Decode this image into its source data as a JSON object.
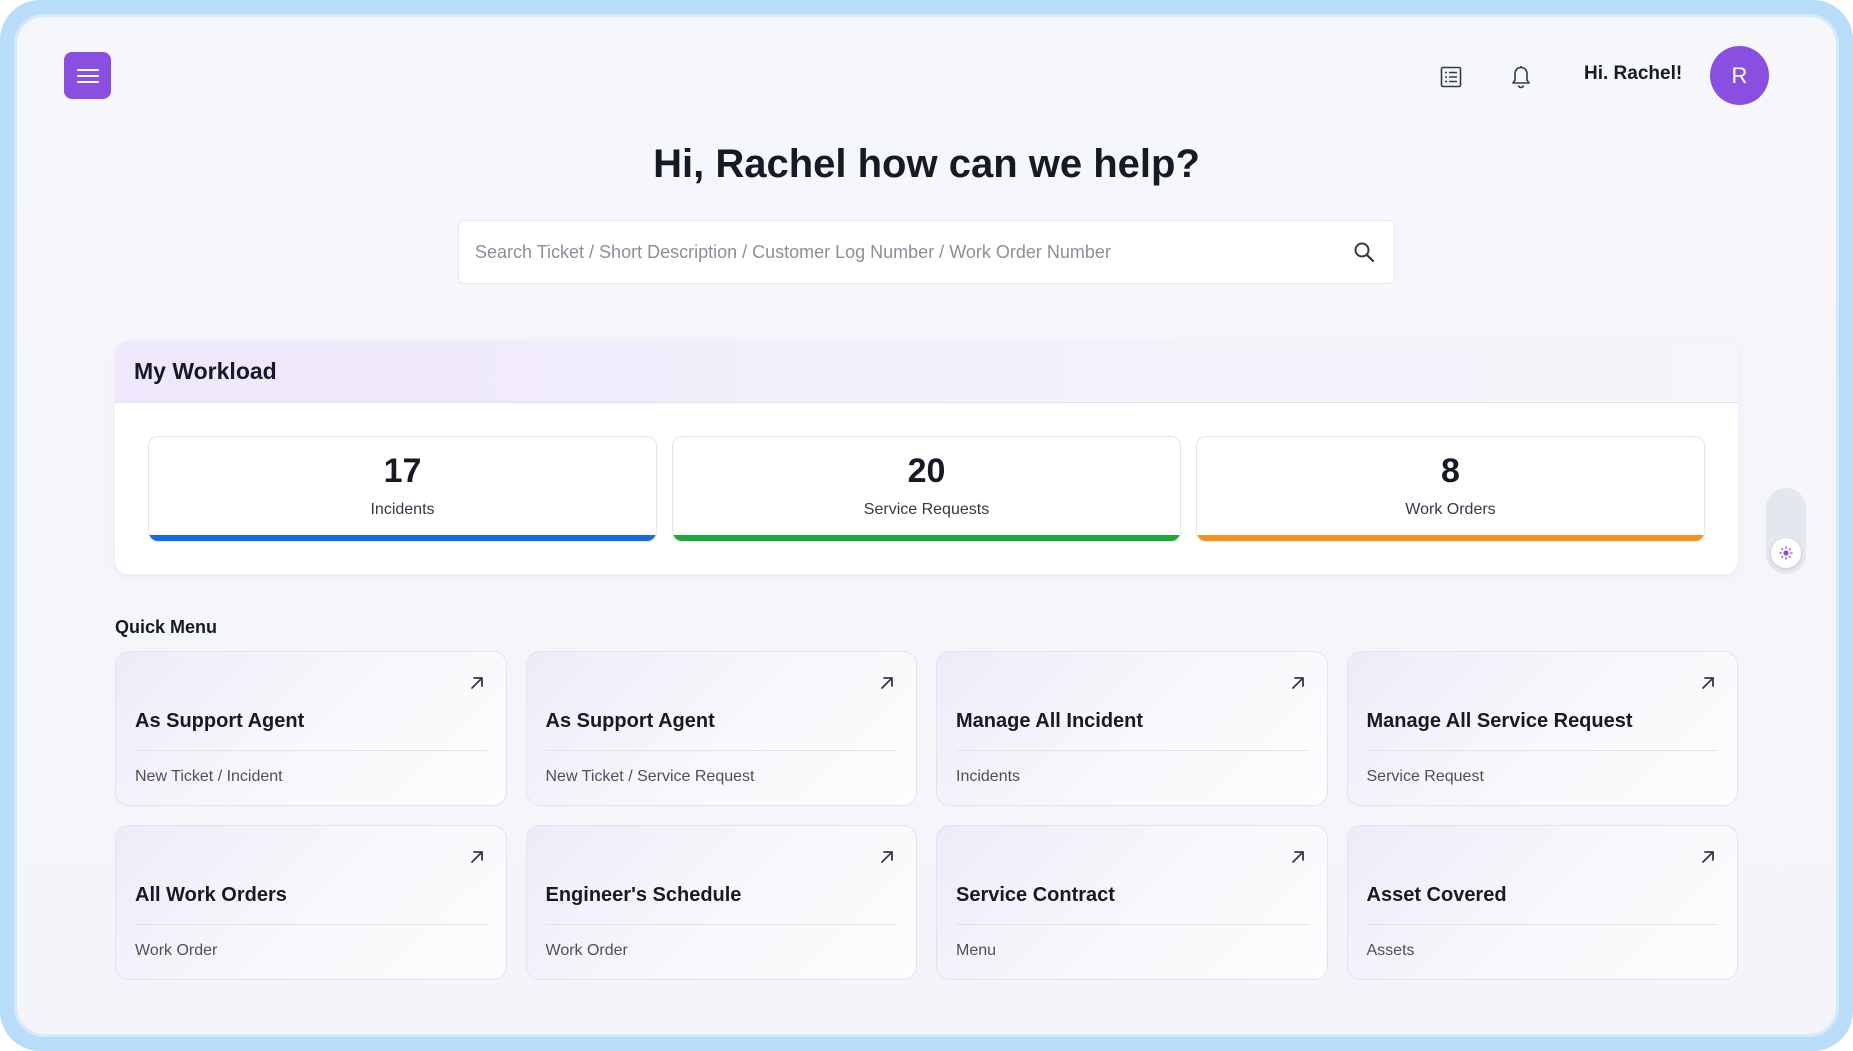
{
  "header": {
    "greeting": "Hi. Rachel!",
    "avatar_initial": "R",
    "icons": [
      "menu-icon",
      "list-icon",
      "bell-icon"
    ]
  },
  "hero": {
    "title": "Hi, Rachel how can we help?",
    "search_placeholder": "Search Ticket / Short Description / Customer Log Number / Work Order Number"
  },
  "workload": {
    "title": "My Workload",
    "stats": [
      {
        "value": "17",
        "label": "Incidents",
        "color": "#1769e6"
      },
      {
        "value": "20",
        "label": "Service Requests",
        "color": "#1ea83a"
      },
      {
        "value": "8",
        "label": "Work Orders",
        "color": "#f5921e"
      }
    ]
  },
  "quick_menu": {
    "title": "Quick Menu",
    "items": [
      {
        "name": "As Support Agent",
        "sub": "New Ticket / Incident"
      },
      {
        "name": "As Support Agent",
        "sub": "New Ticket / Service Request"
      },
      {
        "name": "Manage All Incident",
        "sub": "Incidents"
      },
      {
        "name": "Manage All Service Request",
        "sub": "Service Request"
      },
      {
        "name": "All Work Orders",
        "sub": "Work Order"
      },
      {
        "name": "Engineer's Schedule",
        "sub": "Work Order"
      },
      {
        "name": "Service Contract",
        "sub": "Menu"
      },
      {
        "name": "Asset Covered",
        "sub": "Assets"
      }
    ]
  },
  "colors": {
    "accent": "#8a4fe0",
    "incidents_bar": "#1769e6",
    "service_requests_bar": "#1ea83a",
    "work_orders_bar": "#f5921e"
  }
}
